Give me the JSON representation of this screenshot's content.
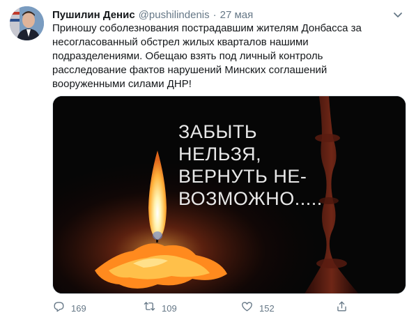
{
  "author": {
    "display_name": "Пушилин Денис",
    "handle": "@pushilindenis",
    "separator": "·",
    "date": "27 мая"
  },
  "tweet": {
    "lines": [
      "Приношу соболезнования пострадавшим жителям Донбасса за",
      "несогласованный обстрел жилых кварталов нашими",
      "подразделениями. Обещаю взять под личный контроль",
      "расследование фактов нарушений Минских соглашений",
      "вооруженными силами ДНР!"
    ]
  },
  "media": {
    "caption_lines": [
      "ЗАБЫТЬ",
      "НЕЛЬЗЯ,",
      "ВЕРНУТЬ НЕ-",
      "ВОЗМОЖНО....."
    ]
  },
  "actions": {
    "replies": "169",
    "retweets": "109",
    "likes": "152"
  },
  "icons": {
    "more": "chevron-down-icon",
    "reply": "reply-icon",
    "retweet": "retweet-icon",
    "like": "heart-icon",
    "share": "share-icon"
  },
  "colors": {
    "text": "#14171a",
    "secondary": "#657786",
    "border": "#e1e8ed"
  }
}
